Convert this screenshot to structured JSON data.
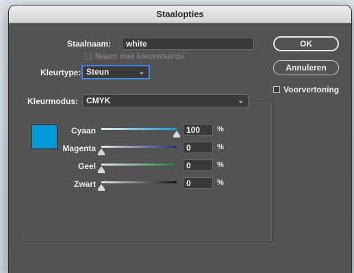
{
  "dialog": {
    "title": "Staalopties"
  },
  "form": {
    "swatch_name_label": "Staalnaam:",
    "swatch_name_value": "white",
    "name_with_color_value_label": "Naam met kleurwaarde",
    "color_type_label": "Kleurtype:",
    "color_type_value": "Steun",
    "color_mode_label": "Kleurmodus:",
    "color_mode_value": "CMYK"
  },
  "buttons": {
    "ok": "OK",
    "cancel": "Annuleren"
  },
  "preview": {
    "label": "Voorvertoning",
    "checked": false
  },
  "swatch_color": "#0099da",
  "sliders": [
    {
      "label": "Cyaan",
      "value": "100",
      "unit": "%",
      "fraction": 1.0,
      "gradient_end": "#009fe3"
    },
    {
      "label": "Magenta",
      "value": "0",
      "unit": "%",
      "fraction": 0.0,
      "gradient_end": "#2a2a7a"
    },
    {
      "label": "Geel",
      "value": "0",
      "unit": "%",
      "fraction": 0.0,
      "gradient_end": "#1e7a3e"
    },
    {
      "label": "Zwart",
      "value": "0",
      "unit": "%",
      "fraction": 0.0,
      "gradient_end": "#0d0d0d"
    }
  ]
}
